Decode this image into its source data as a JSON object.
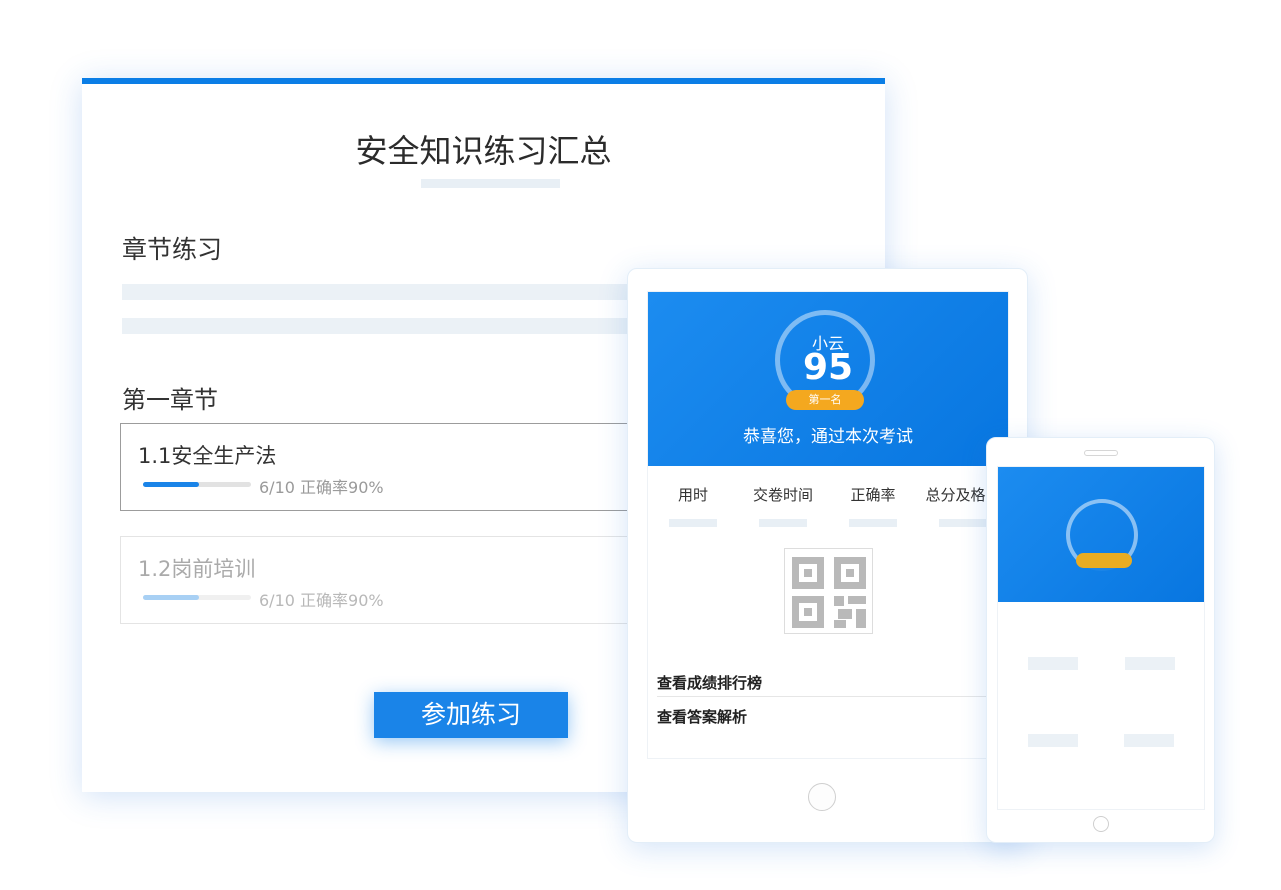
{
  "desktop": {
    "title": "安全知识练习汇总",
    "section_title": "章节练习",
    "chapter_title": "第一章节",
    "lessons": [
      {
        "name": "1.1安全生产法",
        "progress_text": "6/10 正确率90%",
        "progress": 0.6
      },
      {
        "name": "1.2岗前培训",
        "progress_text": "6/10 正确率90%",
        "progress": 0.6
      }
    ],
    "join_button": "参加练习"
  },
  "tablet": {
    "user_name": "小云",
    "score": "95",
    "rank": "第一名",
    "congrats": "恭喜您，通过本次考试",
    "stats": [
      "用时",
      "交卷时间",
      "正确率",
      "总分及格率"
    ],
    "links": [
      "查看成绩排行榜",
      "查看答案解析"
    ]
  },
  "colors": {
    "primary": "#1a84e8",
    "accent": "#f4a81f"
  }
}
